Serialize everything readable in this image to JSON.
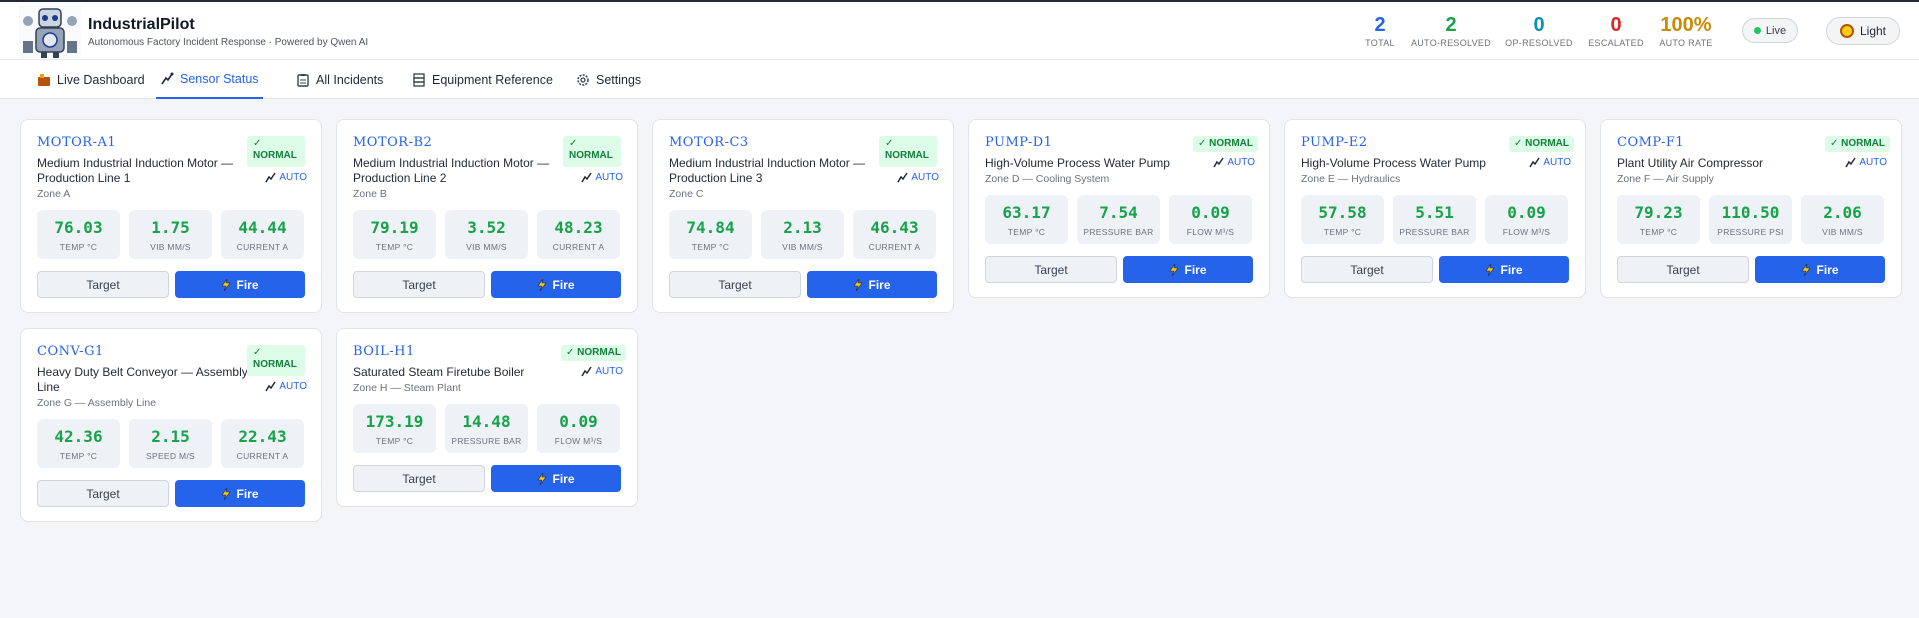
{
  "app": {
    "title": "IndustrialPilot",
    "subtitle": "Autonomous Factory Incident Response · Powered by Qwen AI"
  },
  "stats": [
    {
      "value": "2",
      "label": "TOTAL",
      "color": "#2563eb"
    },
    {
      "value": "2",
      "label": "AUTO-RESOLVED",
      "color": "#16a34a"
    },
    {
      "value": "0",
      "label": "OP-RESOLVED",
      "color": "#0891b2"
    },
    {
      "value": "0",
      "label": "ESCALATED",
      "color": "#dc2626"
    },
    {
      "value": "100%",
      "label": "AUTO RATE",
      "color": "#ca8a04"
    }
  ],
  "status": {
    "live_label": "Live",
    "theme_label": "Light"
  },
  "tabs": [
    {
      "label": "Live Dashboard",
      "icon": "dashboard-icon",
      "active": false
    },
    {
      "label": "Sensor Status",
      "icon": "sensor-icon",
      "active": true
    },
    {
      "label": "All Incidents",
      "icon": "clipboard-icon",
      "active": false
    },
    {
      "label": "Equipment Reference",
      "icon": "server-icon",
      "active": false
    },
    {
      "label": "Settings",
      "icon": "gear-icon",
      "active": false
    }
  ],
  "equipment": [
    {
      "id": "MOTOR-A1",
      "name": "Medium Industrial Induction Motor — Production Line 1",
      "zone": "Zone A",
      "status": "✓ NORMAL",
      "mode": "AUTO",
      "metrics": [
        {
          "value": "76.03",
          "label": "TEMP °C"
        },
        {
          "value": "1.75",
          "label": "VIB MM/S"
        },
        {
          "value": "44.44",
          "label": "CURRENT A"
        }
      ],
      "target_label": "Target",
      "fire_label": "Fire"
    },
    {
      "id": "MOTOR-B2",
      "name": "Medium Industrial Induction Motor — Production Line 2",
      "zone": "Zone B",
      "status": "✓ NORMAL",
      "mode": "AUTO",
      "metrics": [
        {
          "value": "79.19",
          "label": "TEMP °C"
        },
        {
          "value": "3.52",
          "label": "VIB MM/S"
        },
        {
          "value": "48.23",
          "label": "CURRENT A"
        }
      ],
      "target_label": "Target",
      "fire_label": "Fire"
    },
    {
      "id": "MOTOR-C3",
      "name": "Medium Industrial Induction Motor — Production Line 3",
      "zone": "Zone C",
      "status": "✓ NORMAL",
      "mode": "AUTO",
      "metrics": [
        {
          "value": "74.84",
          "label": "TEMP °C"
        },
        {
          "value": "2.13",
          "label": "VIB MM/S"
        },
        {
          "value": "46.43",
          "label": "CURRENT A"
        }
      ],
      "target_label": "Target",
      "fire_label": "Fire"
    },
    {
      "id": "PUMP-D1",
      "name": "High-Volume Process Water Pump",
      "zone": "Zone D — Cooling System",
      "status": "✓ NORMAL",
      "mode": "AUTO",
      "metrics": [
        {
          "value": "63.17",
          "label": "TEMP °C"
        },
        {
          "value": "7.54",
          "label": "PRESSURE BAR"
        },
        {
          "value": "0.09",
          "label": "FLOW M³/S"
        }
      ],
      "target_label": "Target",
      "fire_label": "Fire"
    },
    {
      "id": "PUMP-E2",
      "name": "High-Volume Process Water Pump",
      "zone": "Zone E — Hydraulics",
      "status": "✓ NORMAL",
      "mode": "AUTO",
      "metrics": [
        {
          "value": "57.58",
          "label": "TEMP °C"
        },
        {
          "value": "5.51",
          "label": "PRESSURE BAR"
        },
        {
          "value": "0.09",
          "label": "FLOW M³/S"
        }
      ],
      "target_label": "Target",
      "fire_label": "Fire"
    },
    {
      "id": "COMP-F1",
      "name": "Plant Utility Air Compressor",
      "zone": "Zone F — Air Supply",
      "status": "✓ NORMAL",
      "mode": "AUTO",
      "metrics": [
        {
          "value": "79.23",
          "label": "TEMP °C"
        },
        {
          "value": "110.50",
          "label": "PRESSURE PSI"
        },
        {
          "value": "2.06",
          "label": "VIB MM/S"
        }
      ],
      "target_label": "Target",
      "fire_label": "Fire"
    },
    {
      "id": "CONV-G1",
      "name": "Heavy Duty Belt Conveyor — Assembly Line",
      "zone": "Zone G — Assembly Line",
      "status": "✓ NORMAL",
      "mode": "AUTO",
      "metrics": [
        {
          "value": "42.36",
          "label": "TEMP °C"
        },
        {
          "value": "2.15",
          "label": "SPEED M/S"
        },
        {
          "value": "22.43",
          "label": "CURRENT A"
        }
      ],
      "target_label": "Target",
      "fire_label": "Fire"
    },
    {
      "id": "BOIL-H1",
      "name": "Saturated Steam Firetube Boiler",
      "zone": "Zone H — Steam Plant",
      "status": "✓ NORMAL",
      "mode": "AUTO",
      "metrics": [
        {
          "value": "173.19",
          "label": "TEMP °C"
        },
        {
          "value": "14.48",
          "label": "PRESSURE BAR"
        },
        {
          "value": "0.09",
          "label": "FLOW M³/S"
        }
      ],
      "target_label": "Target",
      "fire_label": "Fire"
    }
  ]
}
